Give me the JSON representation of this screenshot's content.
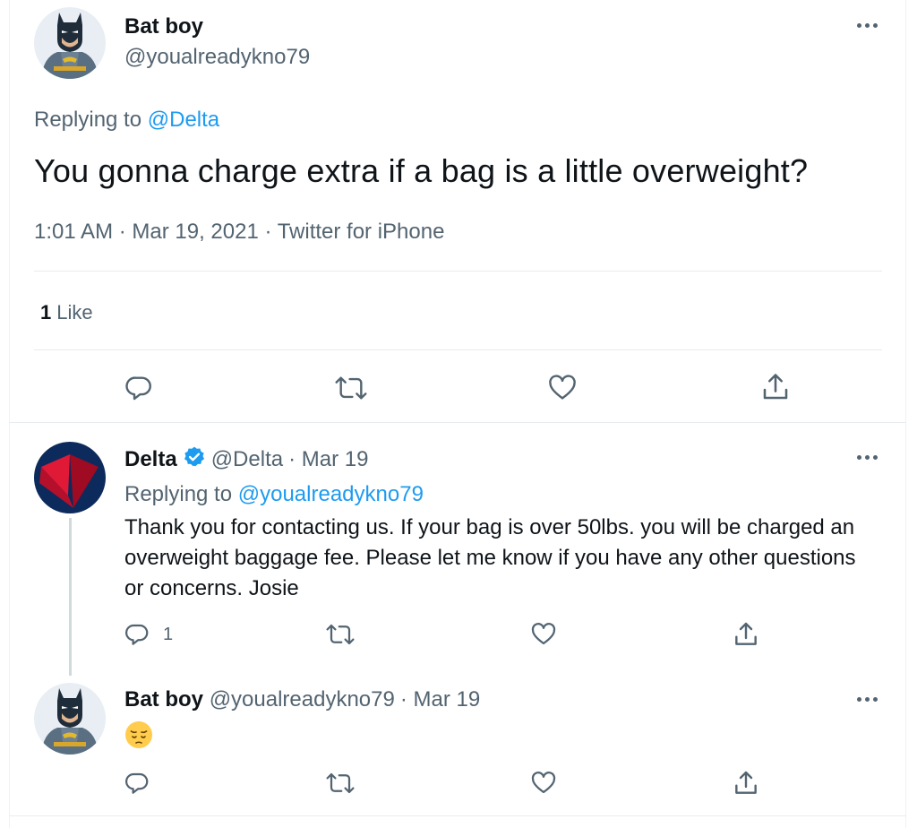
{
  "main_tweet": {
    "author_name": "Bat boy",
    "author_handle": "@youalreadykno79",
    "replying_prefix": "Replying to",
    "replying_to": "@Delta",
    "text": "You gonna charge extra if a bag is a little overweight?",
    "timestamp": "1:01 AM · Mar 19, 2021 · Twitter for iPhone",
    "like_count": "1",
    "like_label": "Like"
  },
  "reply_1": {
    "author_name": "Delta",
    "author_handle": "@Delta",
    "date": "· Mar 19",
    "replying_prefix": "Replying to",
    "replying_to": "@youalreadykno79",
    "text": "Thank you for contacting us. If your bag is over 50lbs. you will be charged an overweight baggage fee. Please let me know if you have any other questions or concerns. Josie",
    "reply_count": "1"
  },
  "reply_2": {
    "author_name": "Bat boy",
    "author_handle": "@youalreadykno79",
    "date": "· Mar 19",
    "emoji": "pensive-face-emoji"
  },
  "icons": {
    "reply": "reply-icon",
    "retweet": "retweet-icon",
    "like": "heart-icon",
    "share": "share-icon",
    "more": "more-icon",
    "verified": "verified-badge-icon"
  },
  "colors": {
    "link": "#1d9bf0",
    "secondary_text": "#536471",
    "delta_red": "#c8102e"
  }
}
